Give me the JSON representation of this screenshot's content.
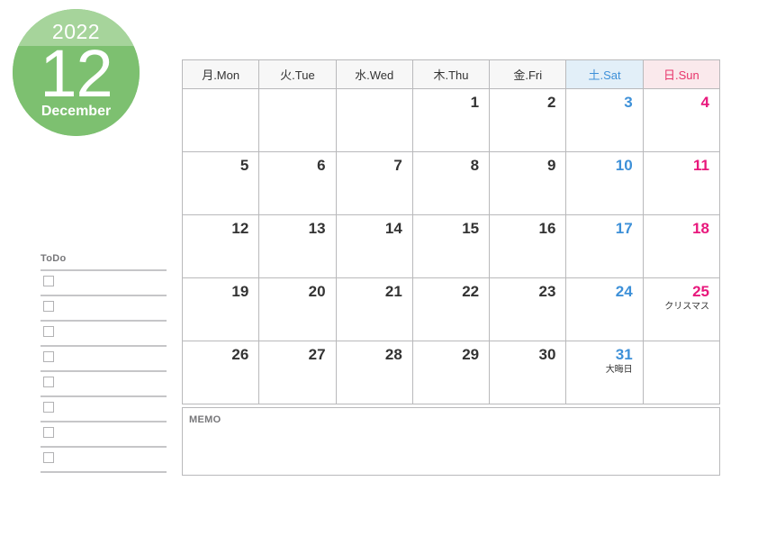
{
  "badge": {
    "year": "2022",
    "month_number": "12",
    "month_name": "December",
    "color_top": "#a6d49b",
    "color_bottom": "#7dc070"
  },
  "calendar": {
    "weekday_headers": [
      {
        "label": "月.Mon",
        "kind": "weekday"
      },
      {
        "label": "火.Tue",
        "kind": "weekday"
      },
      {
        "label": "水.Wed",
        "kind": "weekday"
      },
      {
        "label": "木.Thu",
        "kind": "weekday"
      },
      {
        "label": "金.Fri",
        "kind": "weekday"
      },
      {
        "label": "土.Sat",
        "kind": "sat"
      },
      {
        "label": "日.Sun",
        "kind": "sun"
      }
    ],
    "colors": {
      "saturday_text": "#3d90d8",
      "saturday_header_bg": "#e2eff8",
      "sunday_text": "#e8187c",
      "sunday_header_bg": "#fae9ec",
      "weekday_text": "#333333",
      "header_bg": "#f7f7f7",
      "border": "#b9b9bb"
    },
    "weeks": [
      [
        {
          "day": "",
          "event": "",
          "kind": "weekday"
        },
        {
          "day": "",
          "event": "",
          "kind": "weekday"
        },
        {
          "day": "",
          "event": "",
          "kind": "weekday"
        },
        {
          "day": "1",
          "event": "",
          "kind": "weekday"
        },
        {
          "day": "2",
          "event": "",
          "kind": "weekday"
        },
        {
          "day": "3",
          "event": "",
          "kind": "sat"
        },
        {
          "day": "4",
          "event": "",
          "kind": "sun"
        }
      ],
      [
        {
          "day": "5",
          "event": "",
          "kind": "weekday"
        },
        {
          "day": "6",
          "event": "",
          "kind": "weekday"
        },
        {
          "day": "7",
          "event": "",
          "kind": "weekday"
        },
        {
          "day": "8",
          "event": "",
          "kind": "weekday"
        },
        {
          "day": "9",
          "event": "",
          "kind": "weekday"
        },
        {
          "day": "10",
          "event": "",
          "kind": "sat"
        },
        {
          "day": "11",
          "event": "",
          "kind": "sun"
        }
      ],
      [
        {
          "day": "12",
          "event": "",
          "kind": "weekday"
        },
        {
          "day": "13",
          "event": "",
          "kind": "weekday"
        },
        {
          "day": "14",
          "event": "",
          "kind": "weekday"
        },
        {
          "day": "15",
          "event": "",
          "kind": "weekday"
        },
        {
          "day": "16",
          "event": "",
          "kind": "weekday"
        },
        {
          "day": "17",
          "event": "",
          "kind": "sat"
        },
        {
          "day": "18",
          "event": "",
          "kind": "sun"
        }
      ],
      [
        {
          "day": "19",
          "event": "",
          "kind": "weekday"
        },
        {
          "day": "20",
          "event": "",
          "kind": "weekday"
        },
        {
          "day": "21",
          "event": "",
          "kind": "weekday"
        },
        {
          "day": "22",
          "event": "",
          "kind": "weekday"
        },
        {
          "day": "23",
          "event": "",
          "kind": "weekday"
        },
        {
          "day": "24",
          "event": "",
          "kind": "sat"
        },
        {
          "day": "25",
          "event": "クリスマス",
          "kind": "sun"
        }
      ],
      [
        {
          "day": "26",
          "event": "",
          "kind": "weekday"
        },
        {
          "day": "27",
          "event": "",
          "kind": "weekday"
        },
        {
          "day": "28",
          "event": "",
          "kind": "weekday"
        },
        {
          "day": "29",
          "event": "",
          "kind": "weekday"
        },
        {
          "day": "30",
          "event": "",
          "kind": "weekday"
        },
        {
          "day": "31",
          "event": "大晦日",
          "kind": "sat"
        },
        {
          "day": "",
          "event": "",
          "kind": "sun"
        }
      ]
    ]
  },
  "todo": {
    "title": "ToDo",
    "row_count": 8
  },
  "memo": {
    "label": "MEMO",
    "value": ""
  }
}
